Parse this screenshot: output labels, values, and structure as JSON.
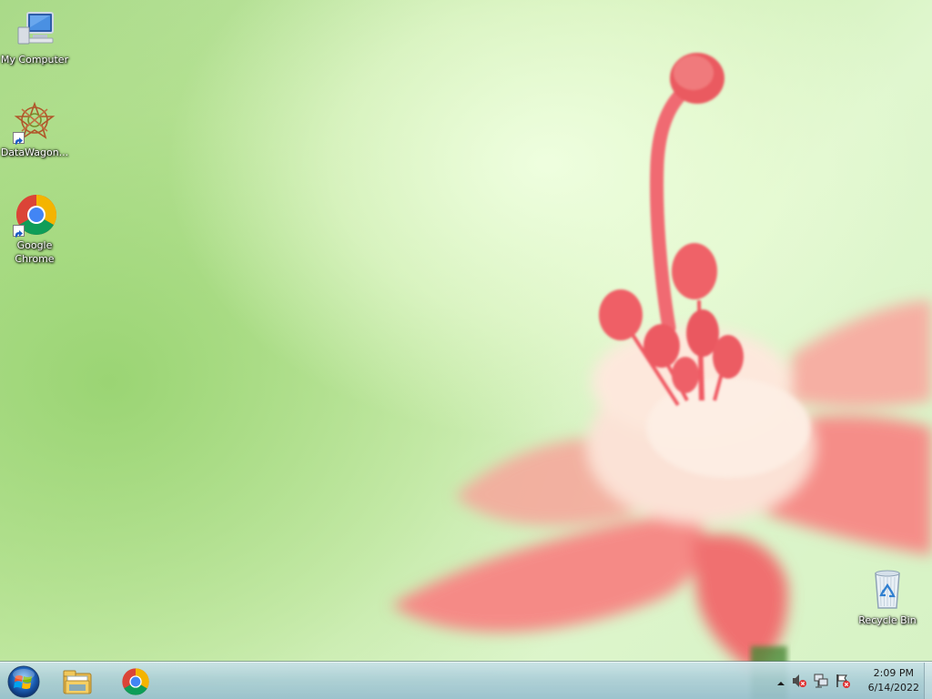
{
  "desktop": {
    "icons": [
      {
        "label": "My Computer"
      },
      {
        "label": "DataWagon..."
      },
      {
        "label": "Google\nChrome"
      },
      {
        "label": "Recycle Bin"
      }
    ]
  },
  "taskbar": {
    "pinned": [
      "windows-explorer-icon",
      "google-chrome-icon"
    ],
    "clock": {
      "time": "2:09 PM",
      "date": "6/14/2022"
    }
  },
  "colors": {
    "taskbar": "#aacdd7",
    "flower": "#f27d7a"
  }
}
